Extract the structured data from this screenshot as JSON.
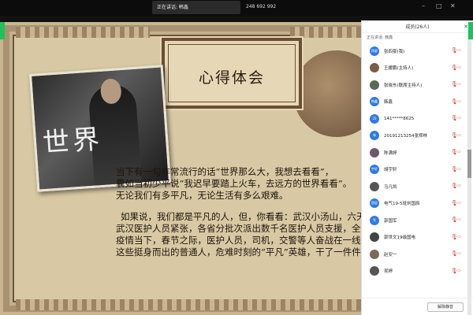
{
  "top_bar": {
    "speaking_toast": "正在讲话: 韩鑫",
    "meeting_id": "248 692 992"
  },
  "window_controls": [
    "minimize-icon",
    "maximize-icon",
    "close-icon"
  ],
  "slide": {
    "title": "心得体会",
    "photo_text": "世界",
    "paragraphs": [
      "当下有一句非常流行的话“世界那么大，我想去看看”，",
      "曩如当初少平说“我迟早要踏上火车，去远方的世界看看”。",
      "无论我们有多平凡，无论生活有多么艰难。",
      "如果说，我们都是平凡的人，但，你看看：武汉小汤山，六天",
      "武汉医护人员紧张，各省分批次派出数千名医护人员支援，全国",
      "疫情当下，春节之际，医护人员，司机，交警等人奋战在一线。",
      "这些挺身而出的普通人，危难时刻的“平凡”英雄，干了一件件"
    ]
  },
  "participants_panel": {
    "title": "成员(26人)",
    "speaking": "正在讲话: 韩鑫",
    "members": [
      {
        "name": "张四豪(我)",
        "avatar": "四豪",
        "color": "#2f7be5"
      },
      {
        "name": "王媛鹏(主持人)",
        "avatar": "",
        "color": "#7a5c45"
      },
      {
        "name": "张晓东(联席主持人)",
        "avatar": "",
        "color": "#556b54"
      },
      {
        "name": "韩鑫",
        "avatar": "韩鑫",
        "color": "#2f7be5"
      },
      {
        "name": "141*****8625",
        "avatar": "25",
        "color": "#2f7be5"
      },
      {
        "name": "20191213254张郑林",
        "avatar": "林",
        "color": "#2f7be5"
      },
      {
        "name": "陈满婷",
        "avatar": "",
        "color": "#6b5a6e"
      },
      {
        "name": "胡宇轩",
        "avatar": "宇轩",
        "color": "#2f7be5"
      },
      {
        "name": "马凡凯",
        "avatar": "",
        "color": "#555"
      },
      {
        "name": "电气19-5班刘国辰",
        "avatar": "国辰",
        "color": "#2f7be5"
      },
      {
        "name": "郭国军",
        "avatar": "军",
        "color": "#2f7be5"
      },
      {
        "name": "郭世文19级国电",
        "avatar": "",
        "color": "#444"
      },
      {
        "name": "赵安一",
        "avatar": "",
        "color": "#7b6a5a"
      },
      {
        "name": "吴婷",
        "avatar": "",
        "color": "#555"
      }
    ],
    "unmute_label": "解除静音"
  }
}
